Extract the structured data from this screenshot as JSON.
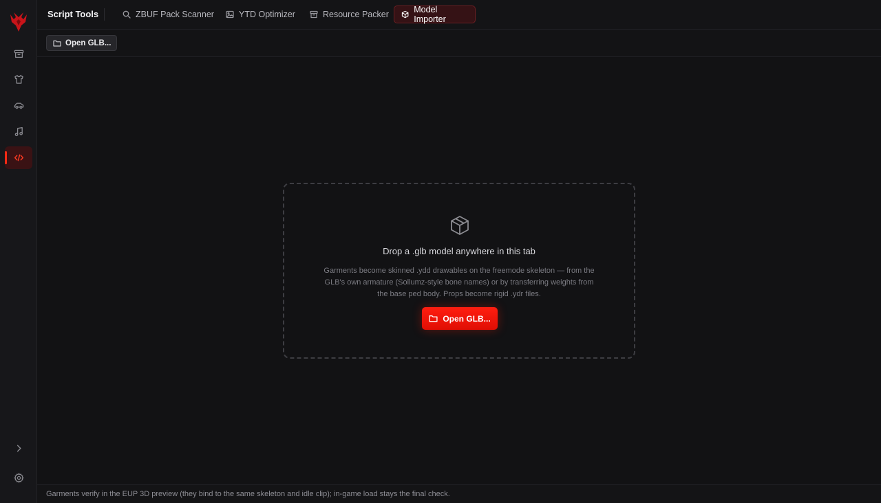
{
  "colors": {
    "accent": "#ff1e10",
    "background": "#121214",
    "sidebar": "#17171a"
  },
  "header": {
    "brand": "Script Tools",
    "tabs": [
      {
        "label": "ZBUF Pack Scanner",
        "icon": "search-icon",
        "active": false
      },
      {
        "label": "YTD Optimizer",
        "icon": "image-icon",
        "active": false
      },
      {
        "label": "Resource Packer",
        "icon": "archive-icon",
        "active": false
      },
      {
        "label": "Model Importer",
        "icon": "cube-icon",
        "active": true
      }
    ]
  },
  "sidebar": {
    "items": [
      {
        "icon": "archive-icon",
        "active": false
      },
      {
        "icon": "shirt-icon",
        "active": false
      },
      {
        "icon": "car-icon",
        "active": false
      },
      {
        "icon": "music-icon",
        "active": false
      },
      {
        "icon": "code-icon",
        "active": true
      }
    ],
    "bottom": [
      {
        "icon": "chevron-right-icon"
      },
      {
        "icon": "gear-icon"
      }
    ]
  },
  "toolbar": {
    "open_label": "Open GLB..."
  },
  "dropzone": {
    "title": "Drop a .glb model anywhere in this tab",
    "description": "Garments become skinned .ydd drawables on the freemode skeleton — from the GLB's own armature (Sollumz-style bone names) or by transferring weights from the base ped body. Props become rigid .ydr files.",
    "button_label": "Open GLB..."
  },
  "status": {
    "text": "Garments verify in the EUP 3D preview (they bind to the same skeleton and idle clip); in-game load stays the final check."
  }
}
